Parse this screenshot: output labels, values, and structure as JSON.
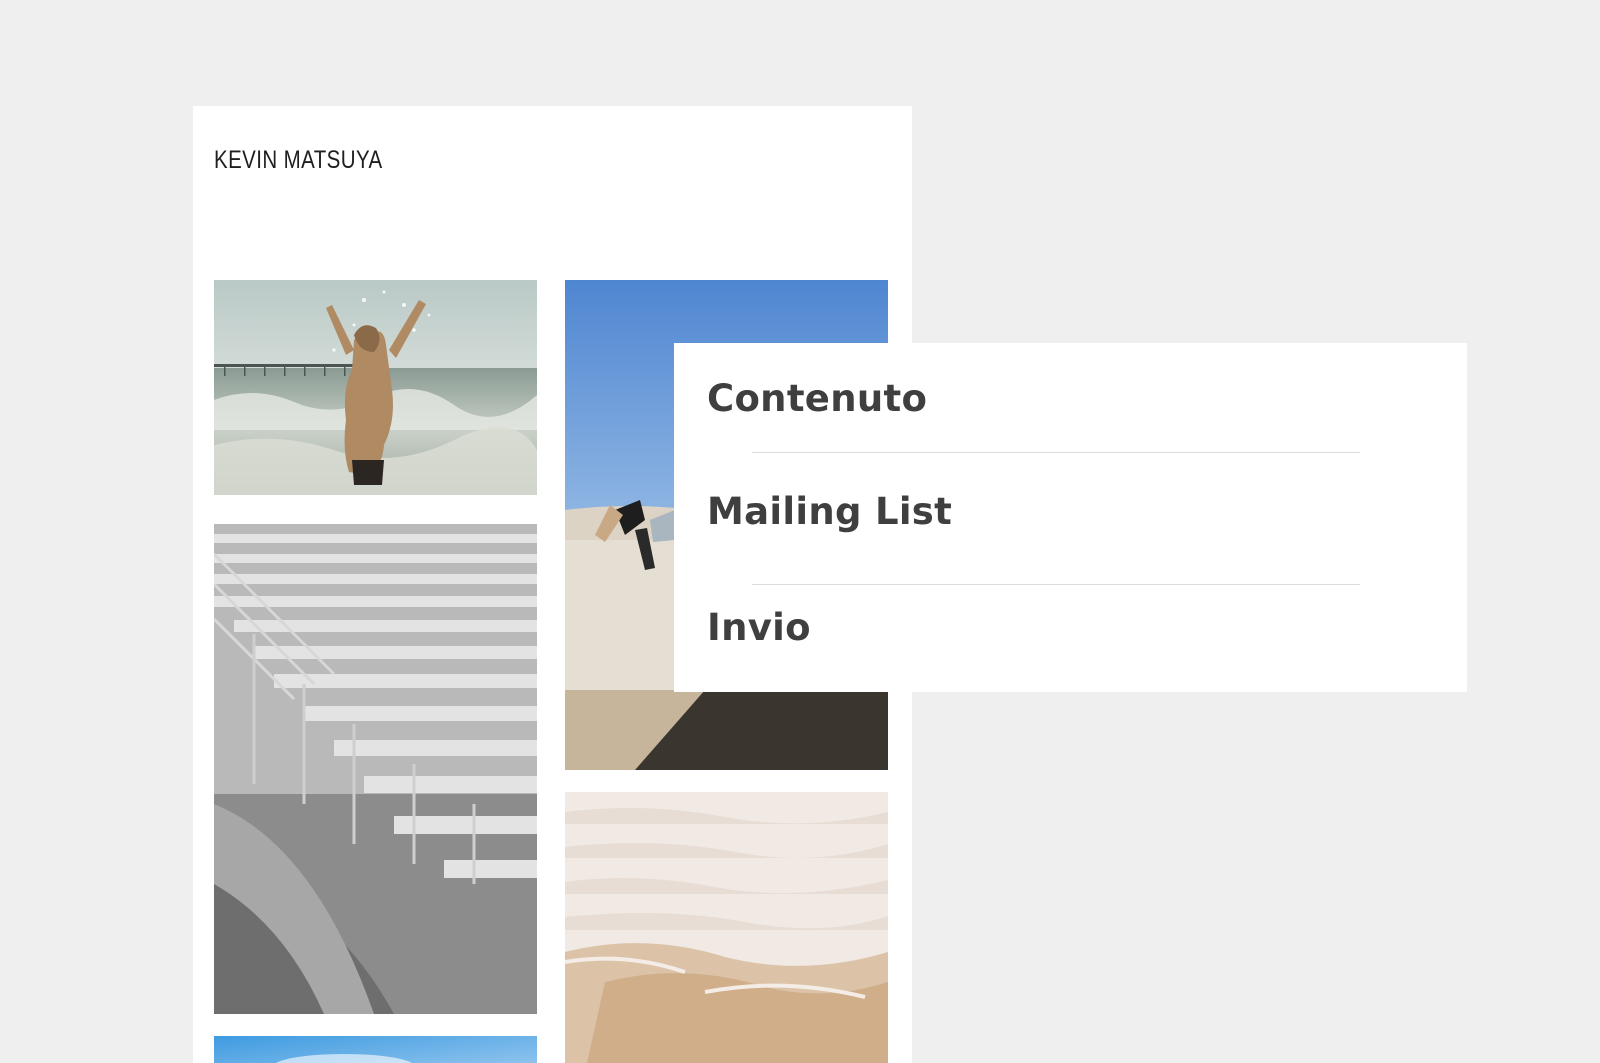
{
  "site": {
    "title": "KEVIN MATSUYA"
  },
  "photos": [
    {
      "name": "beach-splash-photo",
      "alt": "person splashing in ocean waves"
    },
    {
      "name": "jump-photo",
      "alt": "person jumping over white wall"
    },
    {
      "name": "bleachers-photo",
      "alt": "empty bleachers"
    },
    {
      "name": "terraces-photo",
      "alt": "white travertine terraces"
    },
    {
      "name": "sky-photo",
      "alt": "blue sky"
    }
  ],
  "menu": {
    "items": [
      {
        "label": "Contenuto"
      },
      {
        "label": "Mailing List"
      },
      {
        "label": "Invio"
      }
    ]
  },
  "colors": {
    "background": "#efefef",
    "card": "#ffffff",
    "menu_text": "#3f3f3f",
    "title_text": "#1f1f1f",
    "divider": "#dcdcdc"
  }
}
